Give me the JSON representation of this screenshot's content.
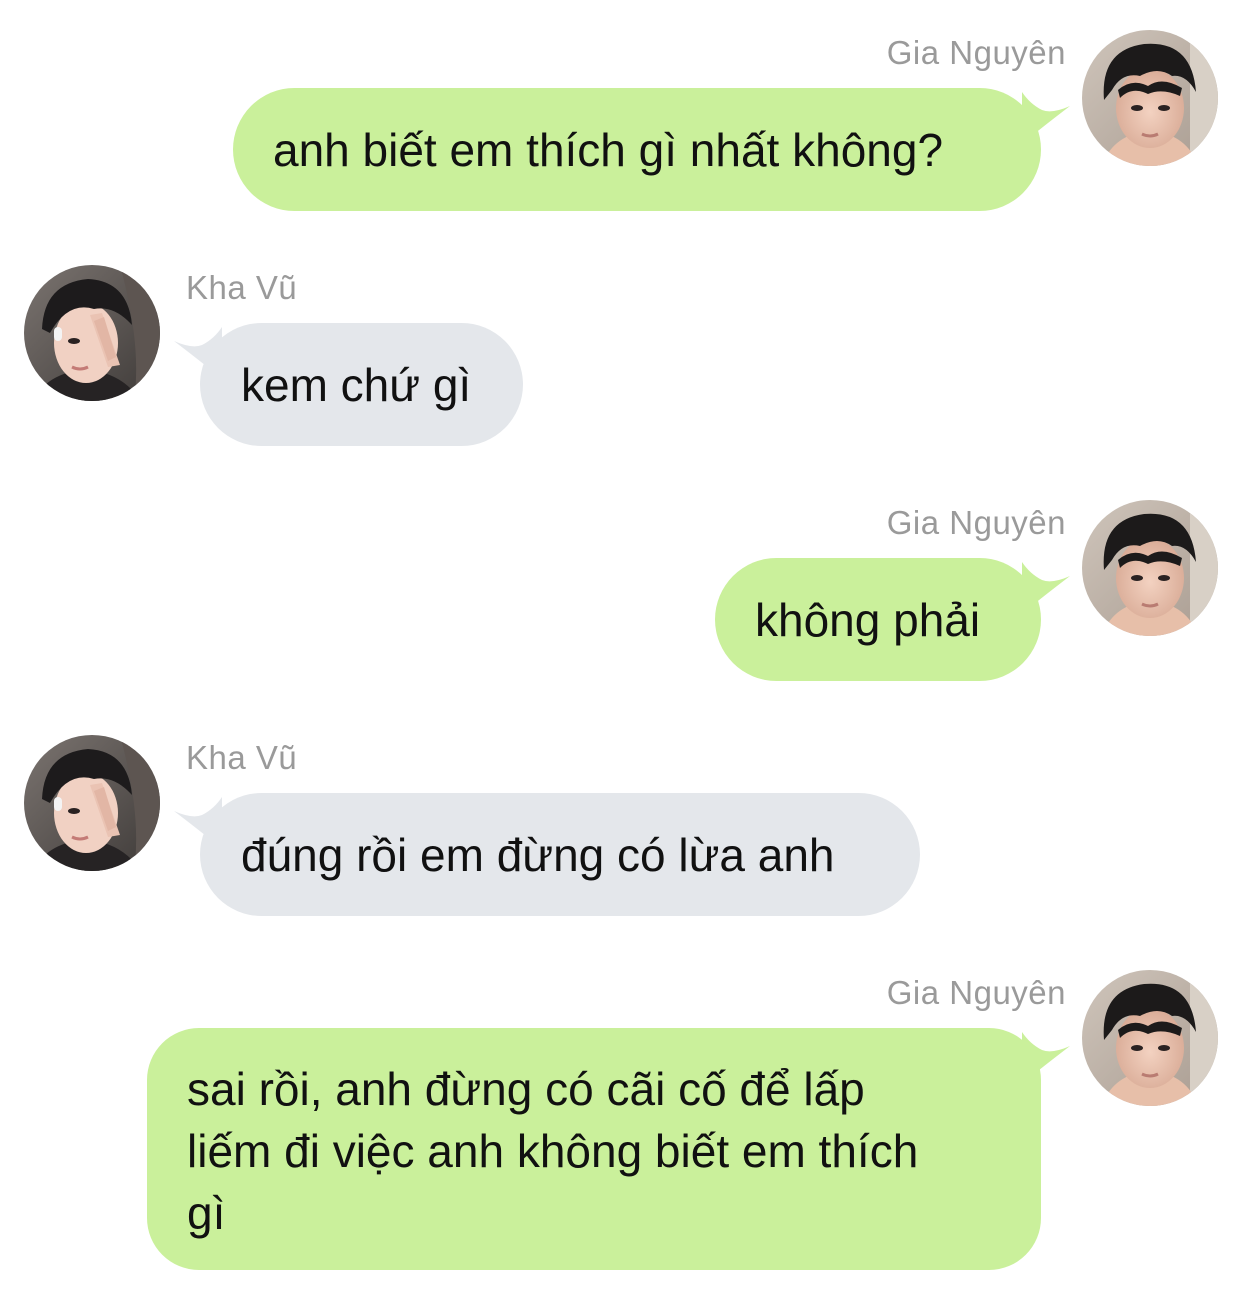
{
  "colors": {
    "sent_bubble": "#caf09b",
    "received_bubble": "#e4e7eb",
    "name_text": "#9a9a9a",
    "message_text": "#111111",
    "background": "#ffffff"
  },
  "participants": {
    "me": {
      "name": "Gia Nguyên",
      "avatar_icon": "profile-photo"
    },
    "other": {
      "name": "Kha Vũ",
      "avatar_icon": "profile-photo"
    }
  },
  "messages": [
    {
      "from": "me",
      "sender": "Gia Nguyên",
      "text": "anh biết em thích gì nhất không?"
    },
    {
      "from": "other",
      "sender": "Kha Vũ",
      "text": "kem chứ gì"
    },
    {
      "from": "me",
      "sender": "Gia Nguyên",
      "text": "không phải"
    },
    {
      "from": "other",
      "sender": "Kha Vũ",
      "text": "đúng rồi em đừng có lừa anh"
    },
    {
      "from": "me",
      "sender": "Gia Nguyên",
      "text": "sai rồi, anh đừng có cãi cố để lấp liếm đi việc anh không biết em thích gì",
      "lines": [
        "sai rồi, anh đừng có cãi cố để lấp",
        "liếm đi việc anh không biết em thích",
        "gì"
      ]
    }
  ]
}
